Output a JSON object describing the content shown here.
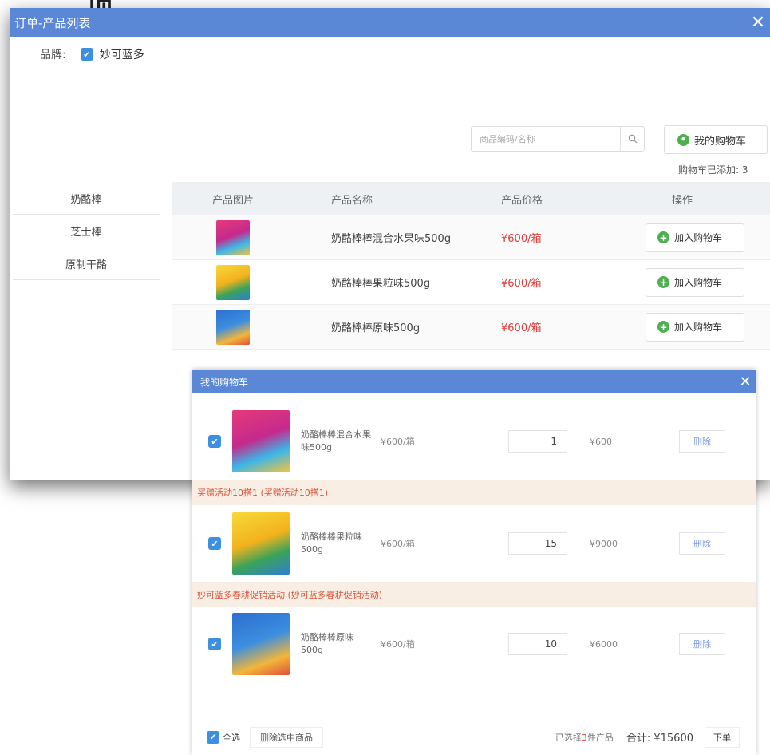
{
  "background": {
    "glyph": "项"
  },
  "dialog": {
    "title": "订单-产品列表",
    "close": "✕",
    "brand_label": "品牌:",
    "brand_name": "妙可蓝多",
    "search_placeholder": "商品编码/名称",
    "cart_button": "我的购物车",
    "cart_added": "购物车已添加: 3"
  },
  "categories": [
    "奶酪棒",
    "芝士棒",
    "原制干酪"
  ],
  "table": {
    "headers": [
      "产品图片",
      "产品名称",
      "产品价格",
      "操作"
    ],
    "rows": [
      {
        "name": "奶酪棒棒混合水果味500g",
        "price": "¥600/箱",
        "action": "加入购物车"
      },
      {
        "name": "奶酪棒棒果粒味500g",
        "price": "¥600/箱",
        "action": "加入购物车"
      },
      {
        "name": "奶酪棒棒原味500g",
        "price": "¥600/箱",
        "action": "加入购物车"
      }
    ]
  },
  "cart": {
    "title": "我的购物车",
    "close": "✕",
    "items": [
      {
        "name": "奶酪棒棒混合水果味500g",
        "price": "¥600/箱",
        "qty": "1",
        "subtotal": "¥600",
        "delete": "删除"
      },
      {
        "name": "奶酪棒棒果粒味500g",
        "price": "¥600/箱",
        "qty": "15",
        "subtotal": "¥9000",
        "delete": "删除"
      },
      {
        "name": "奶酪棒棒原味500g",
        "price": "¥600/箱",
        "qty": "10",
        "subtotal": "¥6000",
        "delete": "删除"
      }
    ],
    "promos": [
      "买赠活动10搭1 (买赠活动10搭1)",
      "妙可蓝多春耕促销活动 (妙可蓝多春耕促销活动)"
    ],
    "footer": {
      "select_all": "全选",
      "delete_selected": "删除选中商品",
      "selected_prefix": "已选择",
      "selected_count": "3",
      "selected_suffix": "件产品",
      "total": "合计: ¥15600",
      "order": "下单"
    }
  },
  "colors": {
    "accent": "#5b88d6",
    "price": "#e53935",
    "promo_bg": "#f8eee4",
    "promo_text": "#d9543b",
    "add_icon": "#4caf50"
  }
}
